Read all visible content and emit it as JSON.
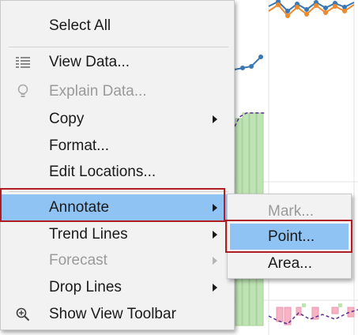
{
  "context_menu": {
    "items": [
      {
        "label": "Select All",
        "icon": "",
        "enabled": true,
        "submenu": false
      },
      {
        "label": "View Data...",
        "icon": "view-data-icon",
        "enabled": true,
        "submenu": false
      },
      {
        "label": "Explain Data...",
        "icon": "lightbulb-icon",
        "enabled": false,
        "submenu": false
      },
      {
        "label": "Copy",
        "icon": "",
        "enabled": true,
        "submenu": true
      },
      {
        "label": "Format...",
        "icon": "",
        "enabled": true,
        "submenu": false
      },
      {
        "label": "Edit Locations...",
        "icon": "",
        "enabled": true,
        "submenu": false
      },
      {
        "label": "Annotate",
        "icon": "",
        "enabled": true,
        "submenu": true,
        "highlighted": true
      },
      {
        "label": "Trend Lines",
        "icon": "",
        "enabled": true,
        "submenu": true
      },
      {
        "label": "Forecast",
        "icon": "",
        "enabled": false,
        "submenu": true
      },
      {
        "label": "Drop Lines",
        "icon": "",
        "enabled": true,
        "submenu": true
      },
      {
        "label": "Show View Toolbar",
        "icon": "zoom-icon",
        "enabled": true,
        "submenu": false
      }
    ]
  },
  "annotate_submenu": {
    "items": [
      {
        "label": "Mark...",
        "enabled": false
      },
      {
        "label": "Point...",
        "enabled": true,
        "highlighted": true
      },
      {
        "label": "Area...",
        "enabled": true
      }
    ]
  },
  "colors": {
    "highlight": "#8fc3f3",
    "callout_border": "#b01e23",
    "series_blue": "#3a78b5",
    "series_orange": "#ee8a2c",
    "bar_green": "#bfe3b4",
    "bar_pink": "#f5b3c4",
    "line_purple": "#5b2c8f"
  }
}
